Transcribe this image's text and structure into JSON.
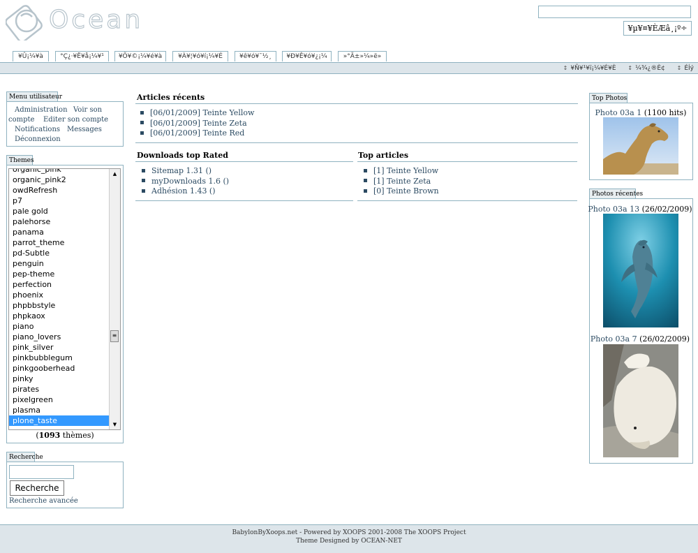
{
  "header": {
    "logo_text": "Ocean",
    "search_button": "¥µ¥¤¥ÈÆâ¸¡º÷",
    "tabs": [
      "¥Û¡¼¥à",
      "°Ç¿·¥Ë¥å¡¼¥¹",
      "¥Õ¥©¡¼¥é¥à",
      "¥À¥¦¥ó¥í¡¼¥É",
      "¥ê¥ó¥¯½¸",
      "¥Ð¥Ê¥ó¥¿¡¼",
      "»°Ã±»¼»ë»"
    ],
    "subnav": [
      "¥Ñ¥¹¥ï¡¼¥É¥È",
      "¼¾¿®È¢",
      "ÉÍý"
    ]
  },
  "usermenu": {
    "title": "Menu utilisateur",
    "items": [
      "Administration",
      "Voir son",
      "compte",
      "Editer son compte",
      "Notifications",
      "Messages",
      "Déconnexion"
    ]
  },
  "themes": {
    "title": "Themes",
    "options": [
      "organic_pink",
      "organic_pink2",
      "owdRefresh",
      "p7",
      "pale gold",
      "palehorse",
      "panama",
      "parrot_theme",
      "pd-Subtle",
      "penguin",
      "pep-theme",
      "perfection",
      "phoenix",
      "phpbbstyle",
      "phpkaox",
      "piano",
      "piano_lovers",
      "pink_silver",
      "pinkbubblegum",
      "pinkgooberhead",
      "pinky",
      "pirates",
      "pixelgreen",
      "plasma",
      "plone_taste"
    ],
    "selected": "plone_taste",
    "count": "1093",
    "count_suffix": " thèmes)",
    "count_prefix": "("
  },
  "search": {
    "title": "Recherche",
    "input_value": "",
    "button": "Recherche",
    "advanced": "Recherche avancée"
  },
  "recent_articles": {
    "title": "Articles récents",
    "items": [
      "[06/01/2009] Teinte Yellow",
      "[06/01/2009] Teinte Zeta",
      "[06/01/2009] Teinte Red"
    ]
  },
  "downloads": {
    "title": "Downloads top Rated",
    "items": [
      "Sitemap 1.31 ()",
      "myDownloads 1.6 ()",
      "Adhésion 1.43 ()"
    ]
  },
  "top_articles": {
    "title": "Top articles",
    "items": [
      "[1] Teinte Yellow",
      "[1] Teinte Zeta",
      "[0] Teinte Brown"
    ]
  },
  "top_photos": {
    "title": "Top Photos",
    "items": [
      {
        "name": "Photo 03a 1",
        "meta": " (1100 hits)",
        "subject": "camel"
      }
    ]
  },
  "recent_photos": {
    "title": "Photos récentes",
    "items": [
      {
        "name": "Photo 03a 13",
        "meta": " (26/02/2009)",
        "subject": "dolphin"
      },
      {
        "name": "Photo 03a 7",
        "meta": " (26/02/2009)",
        "subject": "polar bear"
      }
    ]
  },
  "footer": {
    "line1": "BabylonByXoops.net - Powered by XOOPS 2001-2008 The XOOPS Project",
    "line2": "Theme Designed by OCEAN-NET"
  },
  "colors": {
    "accent": "#8fb2c0",
    "link": "#2b4a62",
    "bar": "#dde5ea",
    "selected": "#3399ff"
  }
}
